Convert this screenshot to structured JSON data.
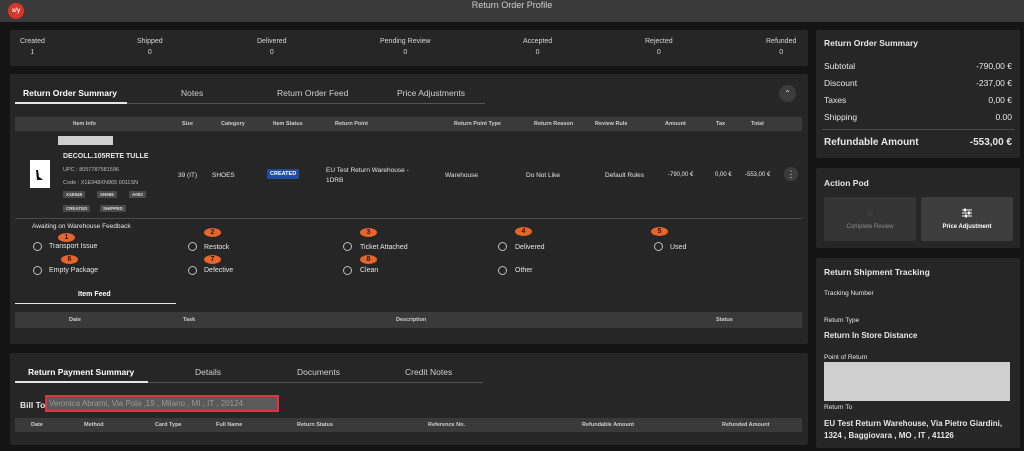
{
  "app": {
    "logo_text": "x/y",
    "title": "Return Order Profile"
  },
  "status_bar": [
    {
      "label": "Created",
      "count": "1"
    },
    {
      "label": "Shipped",
      "count": "0"
    },
    {
      "label": "Delivered",
      "count": "0"
    },
    {
      "label": "Pending Review",
      "count": "0"
    },
    {
      "label": "Accepted",
      "count": "0"
    },
    {
      "label": "Rejected",
      "count": "0"
    },
    {
      "label": "Refunded",
      "count": "0"
    }
  ],
  "order_tabs": [
    "Return Order Summary",
    "Notes",
    "Return Order Feed",
    "Price Adjustments"
  ],
  "collapse_icon": "chevron-up-icon",
  "items_table": {
    "headers": [
      "Item Info",
      "Size",
      "Category",
      "Item Status",
      "Return Point",
      "Return Point Type",
      "Return Reason",
      "Review Rule",
      "Amount",
      "Tax",
      "Total"
    ],
    "row": {
      "name": "DECOLL.105RETE TULLE",
      "upc": "UPC : 8057787581596",
      "code": "Code : X1E948XN965 0011SN",
      "chips": [
        "X1E948",
        "XN965",
        "A093"
      ],
      "chips2": [
        "CREATED",
        "SHIPPED"
      ],
      "size": "39 (IT)",
      "category": "SHOES",
      "status": "CREATED",
      "return_point": "EU Test Return Warehouse - 1DRB",
      "return_point_type": "Warehouse",
      "return_reason": "Do Not Like",
      "review_rule": "Default Rules",
      "amount": "-790,00 €",
      "tax": "0,00 €",
      "total": "-553,00 €"
    }
  },
  "feedback": {
    "title": "Awaiting on Warehouse Feedback",
    "options": [
      {
        "label": "Transport Issue",
        "marker": "1"
      },
      {
        "label": "Restock",
        "marker": "2"
      },
      {
        "label": "Ticket Attached",
        "marker": "3"
      },
      {
        "label": "Delivered",
        "marker": "4"
      },
      {
        "label": "Used",
        "marker": "5"
      },
      {
        "label": "Empty Package",
        "marker": "6"
      },
      {
        "label": "Defective",
        "marker": "7"
      },
      {
        "label": "Clean",
        "marker": "8"
      },
      {
        "label": "Other",
        "marker": ""
      }
    ]
  },
  "item_feed": {
    "tab": "Item Feed",
    "headers": [
      "Date",
      "Task",
      "Description",
      "Status"
    ]
  },
  "payment": {
    "tabs": [
      "Return Payment Summary",
      "Details",
      "Documents",
      "Credit Notes"
    ],
    "bill_to_label": "Bill To",
    "bill_to_value": "Veronica Abrami, Via Pola ,19 , Milano , MI , IT , 20124",
    "headers": [
      "Date",
      "Method",
      "Card Type",
      "Full Name",
      "Return Status",
      "Reference No.",
      "Refundable Amount",
      "Refunded Amount"
    ]
  },
  "summary": {
    "title": "Return Order Summary",
    "rows": [
      {
        "label": "Subtotal",
        "value": "-790,00 €"
      },
      {
        "label": "Discount",
        "value": "-237,00 €"
      },
      {
        "label": "Taxes",
        "value": "0,00 €"
      },
      {
        "label": "Shipping",
        "value": "0.00"
      }
    ],
    "refundable_label": "Refundable Amount",
    "refundable_value": "-553,00 €"
  },
  "action_pod": {
    "title": "Action Pod",
    "complete_review": "Complete Review",
    "price_adjustment": "Price Adjustment"
  },
  "tracking": {
    "title": "Return Shipment Tracking",
    "tracking_number_label": "Tracking Number",
    "return_type_label": "Return Type",
    "return_type_value": "Return In Store Distance",
    "point_of_return_label": "Point of Return",
    "return_to_label": "Return To",
    "return_to_value": "EU Test Return Warehouse, Via Pietro Giardini, 1324 , Baggiovara , MO , IT , 41126"
  },
  "colors": {
    "marker": "#e8642b",
    "status_badge": "#1f4ea1",
    "highlight_border": "#e0323a"
  }
}
